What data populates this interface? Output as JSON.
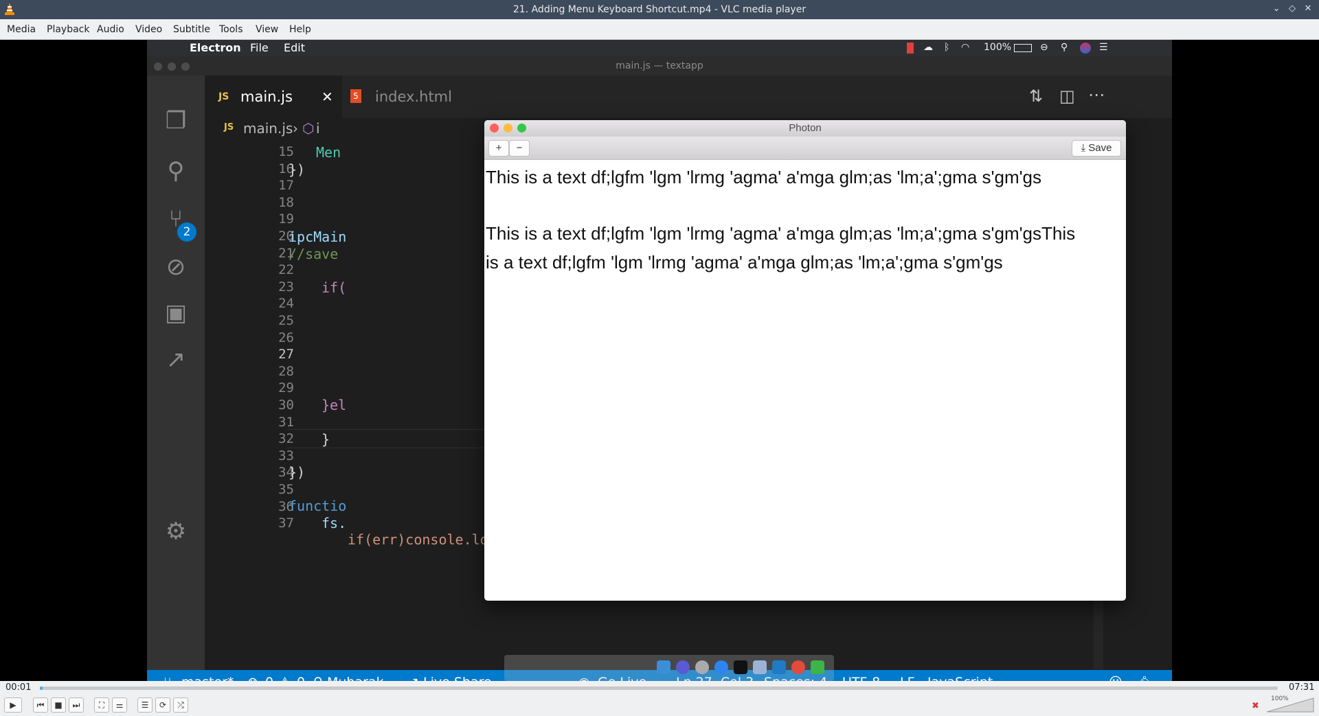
{
  "window": {
    "title": "21. Adding Menu Keyboard Shortcut.mp4 - VLC media player"
  },
  "vlc_menu": [
    "Media",
    "Playback",
    "Audio",
    "Video",
    "Subtitle",
    "Tools",
    "View",
    "Help"
  ],
  "mac_menubar": {
    "app": "Electron",
    "items": [
      "File",
      "Edit"
    ],
    "battery": "100%"
  },
  "vscode": {
    "title": "main.js — textapp",
    "tabs": [
      {
        "label": "main.js",
        "icon": "JS",
        "active": true
      },
      {
        "label": "index.html",
        "icon": "5",
        "active": false
      }
    ],
    "breadcrumb": [
      "main.js",
      "i"
    ],
    "scm_badge": "2",
    "line_numbers": [
      "15",
      "16",
      "17",
      "18",
      "19",
      "20",
      "21",
      "22",
      "23",
      "24",
      "25",
      "26",
      "27",
      "28",
      "29",
      "30",
      "31",
      "32",
      "33",
      "34",
      "35",
      "36",
      "37"
    ],
    "code": {
      "l15": "Men",
      "l16": "})",
      "l19": "ipcMain",
      "l20": "//save",
      "l22": "if(",
      "l29": "}el",
      "l31": "}",
      "l33": "})",
      "l35": "functio",
      "l36": "fs.",
      "l37": "if(err)console.log('there was an error', err)"
    },
    "status": {
      "branch": "master*",
      "errors": "0",
      "warnings": "0",
      "user": "Mubarak",
      "live_share": "Live Share",
      "go_live": "Go Live",
      "position": "Ln 27, Col 3",
      "spaces": "Spaces: 4",
      "encoding": "UTF-8",
      "eol": "LF",
      "language": "JavaScript"
    }
  },
  "photon": {
    "title": "Photon",
    "plus": "+",
    "minus": "−",
    "save": "Save",
    "line1": "This is a text df;lgfm 'lgm 'lrmg 'agma' a'mga glm;as 'lm;a';gma s'gm'gs",
    "line2": "This is a text df;lgfm 'lgm 'lrmg 'agma' a'mga glm;as 'lm;a';gma s'gm'gsThis",
    "line3": "is a text df;lgfm 'lgm 'lrmg 'agma' a'mga glm;as 'lm;a';gma s'gm'gs"
  },
  "player": {
    "elapsed": "00:01",
    "total": "07:31",
    "progress": 0.002,
    "volume_label": "100%"
  }
}
